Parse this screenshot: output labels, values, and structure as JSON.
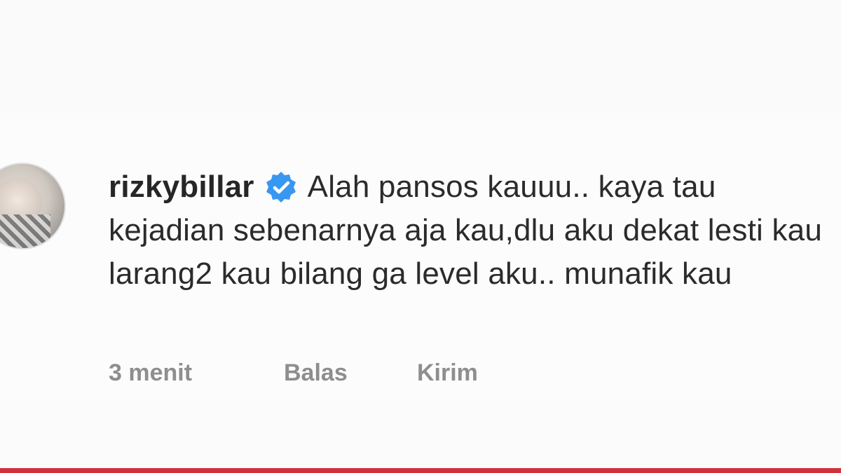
{
  "comment": {
    "username": "rizkybillar",
    "verified_icon": "verified-badge-icon",
    "text": "Alah pansos kauuu.. kaya tau kejadian sebenarnya aja kau,dlu aku dekat lesti kau larang2 kau bilang ga level aku.. munafik kau",
    "timestamp": "3 menit",
    "reply_label": "Balas",
    "send_label": "Kirim"
  },
  "colors": {
    "username": "#262626",
    "text": "#262626",
    "meta": "#8e8e8e",
    "verified": "#3897f0",
    "bottom_line": "#d0323a"
  }
}
